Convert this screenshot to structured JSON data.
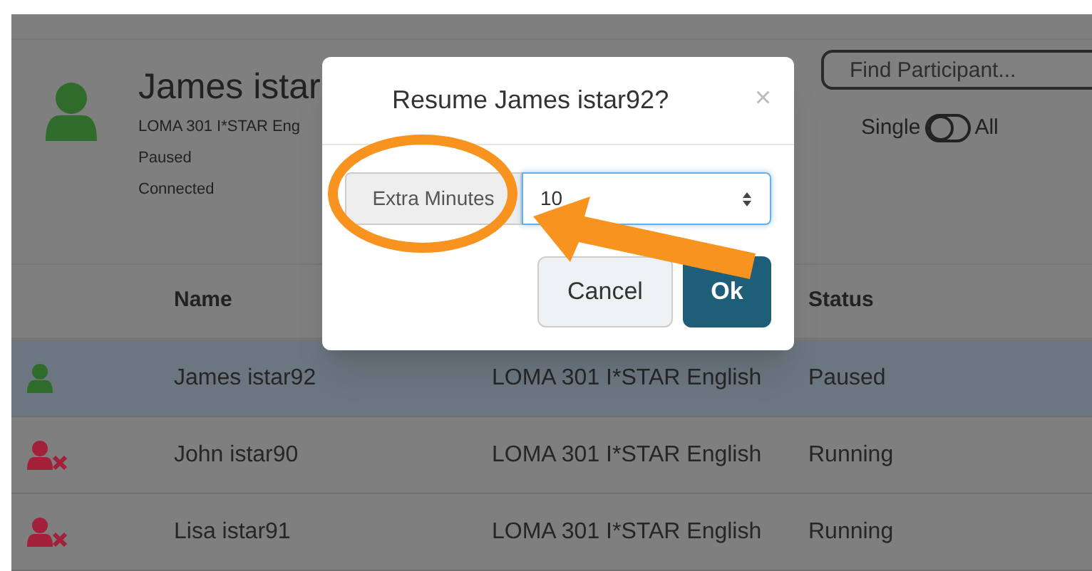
{
  "participant": {
    "name": "James istar",
    "course": "LOMA 301 I*STAR Eng",
    "status": "Paused",
    "connection": "Connected",
    "connected": true
  },
  "search": {
    "placeholder": "Find Participant..."
  },
  "view_toggle": {
    "left_label": "Single",
    "right_label": "All",
    "on": false
  },
  "table": {
    "columns": [
      "Name",
      "Status"
    ],
    "rows": [
      {
        "name": "James istar92",
        "course": "LOMA 301 I*STAR English",
        "status": "Paused",
        "connected": true,
        "selected": true
      },
      {
        "name": "John istar90",
        "course": "LOMA 301 I*STAR English",
        "status": "Running",
        "connected": false,
        "selected": false
      },
      {
        "name": "Lisa istar91",
        "course": "LOMA 301 I*STAR English",
        "status": "Running",
        "connected": false,
        "selected": false
      }
    ]
  },
  "dialog": {
    "title": "Resume James istar92?",
    "close": "×",
    "field": {
      "label": "Extra Minutes",
      "value": "10"
    },
    "buttons": [
      {
        "label": "Cancel",
        "kind": "secondary"
      },
      {
        "label": "Ok",
        "kind": "primary"
      }
    ]
  }
}
